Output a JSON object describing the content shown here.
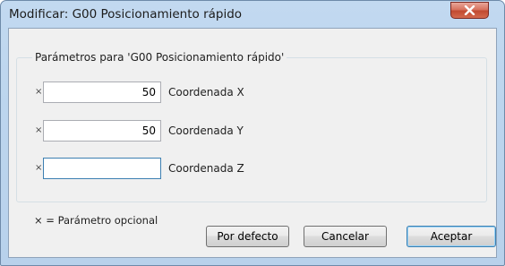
{
  "window": {
    "title": "Modificar: G00 Posicionamiento rápido"
  },
  "group": {
    "legend": "Parámetros para 'G00 Posicionamiento rápido'"
  },
  "fields": [
    {
      "optional_mark": "×",
      "value": "50",
      "label": "Coordenada X"
    },
    {
      "optional_mark": "×",
      "value": "50",
      "label": "Coordenada Y"
    },
    {
      "optional_mark": "×",
      "value": "",
      "label": "Coordenada Z"
    }
  ],
  "footer": {
    "legend_note": "× = Parámetro opcional"
  },
  "buttons": {
    "defaults_label": "Por defecto",
    "cancel_label": "Cancelar",
    "accept_label": "Aceptar"
  },
  "colors": {
    "titlebar": "#bcd5ee",
    "close_button": "#c14a31",
    "default_button_border": "#3c7fb1"
  }
}
